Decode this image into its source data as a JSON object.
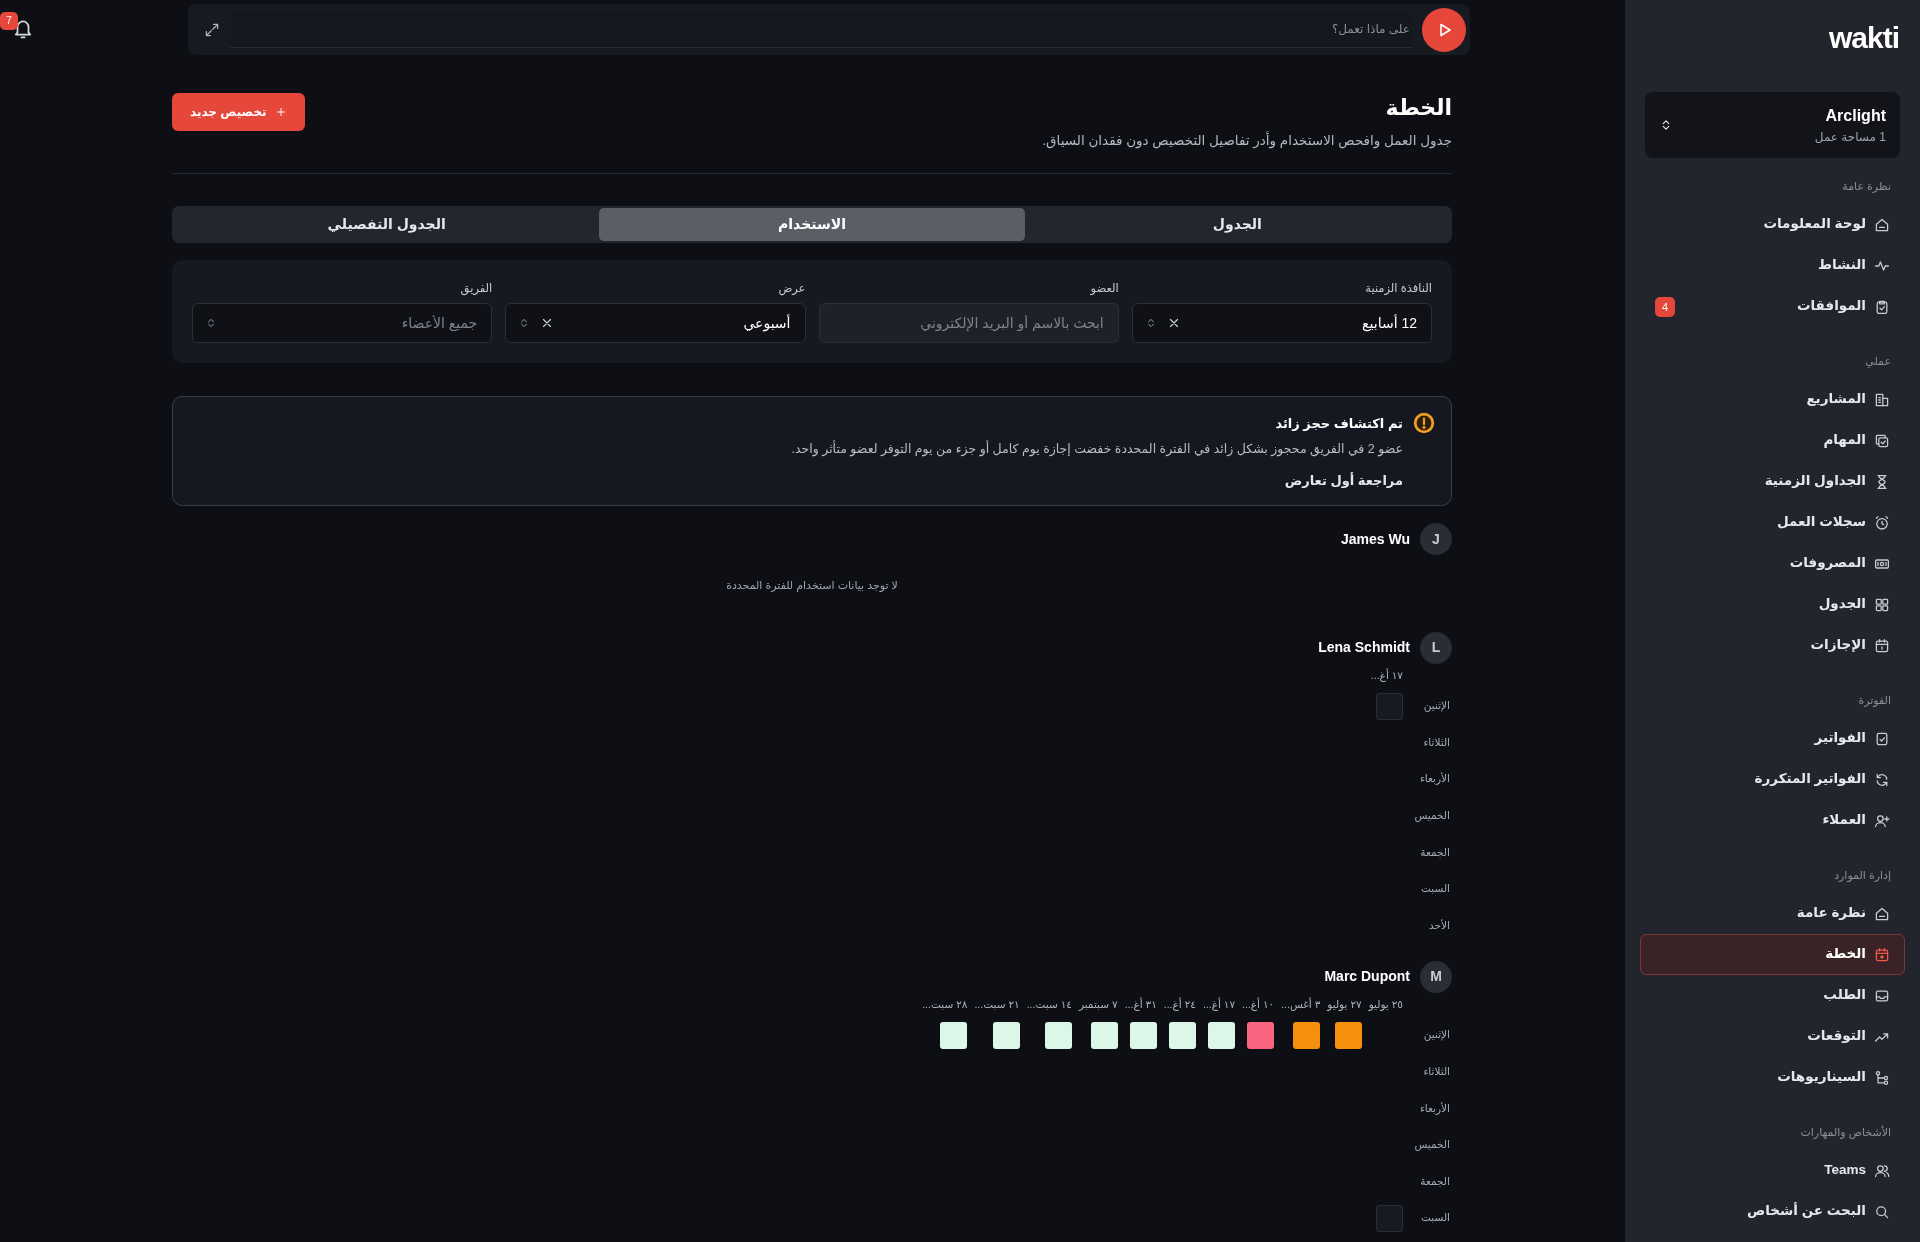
{
  "notifications": {
    "count": "7"
  },
  "timer": {
    "placeholder": "على ماذا تعمل؟"
  },
  "page": {
    "title": "الخطة",
    "subtitle": "جدول العمل وافحص الاستخدام وأدر تفاصيل التخصيص دون فقدان السياق.",
    "new_button": "تخصيص جديد"
  },
  "tabs": [
    {
      "label": "الجدول",
      "selected": false
    },
    {
      "label": "الاستخدام",
      "selected": true
    },
    {
      "label": "الجدول التفصيلي",
      "selected": false
    }
  ],
  "filters": [
    {
      "label": "النافذة الزمنية",
      "kind": "select",
      "value": "12 أسابيع",
      "clearable": true
    },
    {
      "label": "العضو",
      "kind": "search",
      "placeholder": "ابحث بالاسم أو البريد الإلكتروني"
    },
    {
      "label": "عرض",
      "kind": "select",
      "value": "أسبوعي",
      "clearable": true
    },
    {
      "label": "الفريق",
      "kind": "select",
      "placeholder": "جميع الأعضاء",
      "clearable": false
    }
  ],
  "alert": {
    "title": "تم اكتشاف حجز زائد",
    "body": "عضو 2 في الفريق محجوز بشكل زائد في الفترة المحددة خفضت إجازة يوم كامل أو جزء من يوم التوفر لعضو متأثر واحد.",
    "link": "مراجعة أول تعارض"
  },
  "members": [
    {
      "initial": "J",
      "name": "James Wu",
      "empty_text": "لا توجد بيانات استخدام للفترة المحددة"
    },
    {
      "initial": "L",
      "name": "Lena Schmidt",
      "weeks": [
        "١٧ أغ..."
      ],
      "days": [
        {
          "label": "الإثنين",
          "cells": [
            {
              "kind": "empty"
            }
          ]
        },
        {
          "label": "الثلاثاء"
        },
        {
          "label": "الأربعاء"
        },
        {
          "label": "الخميس"
        },
        {
          "label": "الجمعة"
        },
        {
          "label": "السبت"
        },
        {
          "label": "الأحد"
        }
      ]
    },
    {
      "initial": "M",
      "name": "Marc Dupont",
      "weeks": [
        "٢٥ يوليو",
        "٢٧ يوليو",
        "٣ أغس...",
        "١٠ أغ...",
        "١٧ أغ...",
        "٢٤ أغ...",
        "٣١ أغ...",
        "٧ سبتمبر",
        "١٤ سبت...",
        "٢١ سبت...",
        "٢٨ سبت..."
      ],
      "days": [
        {
          "label": "الإثنين",
          "cells": [
            null,
            {
              "kind": "filled",
              "color": "#f5900f"
            },
            {
              "kind": "filled",
              "color": "#f5900f"
            },
            {
              "kind": "filled",
              "color": "#fb6480"
            },
            {
              "kind": "filled",
              "color": "#dcf7e8"
            },
            {
              "kind": "filled",
              "color": "#dcf7e8"
            },
            {
              "kind": "filled",
              "color": "#dcf7e8"
            },
            {
              "kind": "filled",
              "color": "#dcf7e8"
            },
            {
              "kind": "filled",
              "color": "#dcf7e8"
            },
            {
              "kind": "filled",
              "color": "#dcf7e8"
            },
            {
              "kind": "filled",
              "color": "#dcf7e8"
            }
          ]
        },
        {
          "label": "الثلاثاء"
        },
        {
          "label": "الأربعاء"
        },
        {
          "label": "الخميس"
        },
        {
          "label": "الجمعة"
        },
        {
          "label": "السبت",
          "cells": [
            {
              "kind": "empty"
            }
          ]
        }
      ]
    }
  ],
  "sidebar": {
    "logo": "wakti",
    "workspace": {
      "name": "Arclight",
      "count": "1 مساحة عمل"
    },
    "sections": [
      {
        "title": "نظرة عامة",
        "items": [
          {
            "label": "لوحة المعلومات",
            "selected": false
          },
          {
            "label": "النشاط",
            "selected": false
          },
          {
            "label": "الموافقات",
            "selected": false,
            "badge": "4"
          }
        ]
      },
      {
        "title": "عملي",
        "items": [
          {
            "label": "المشاريع",
            "selected": false
          },
          {
            "label": "المهام",
            "selected": false
          },
          {
            "label": "الجداول الزمنية",
            "selected": false
          },
          {
            "label": "سجلات العمل",
            "selected": false
          },
          {
            "label": "المصروفات",
            "selected": false
          },
          {
            "label": "الجدول",
            "selected": false
          },
          {
            "label": "الإجازات",
            "selected": false
          }
        ]
      },
      {
        "title": "الفوترة",
        "items": [
          {
            "label": "الفواتير",
            "selected": false
          },
          {
            "label": "الفواتير المتكررة",
            "selected": false
          },
          {
            "label": "العملاء",
            "selected": false
          }
        ]
      },
      {
        "title": "إدارة الموارد",
        "items": [
          {
            "label": "نظرة عامة",
            "selected": false
          },
          {
            "label": "الخطة",
            "selected": true
          },
          {
            "label": "الطلب",
            "selected": false
          },
          {
            "label": "التوقعات",
            "selected": false
          },
          {
            "label": "السيناريوهات",
            "selected": false
          }
        ]
      },
      {
        "title": "الأشخاص والمهارات",
        "items": [
          {
            "label": "Teams",
            "selected": false
          },
          {
            "label": "البحث عن أشخاص",
            "selected": false
          }
        ]
      }
    ]
  }
}
